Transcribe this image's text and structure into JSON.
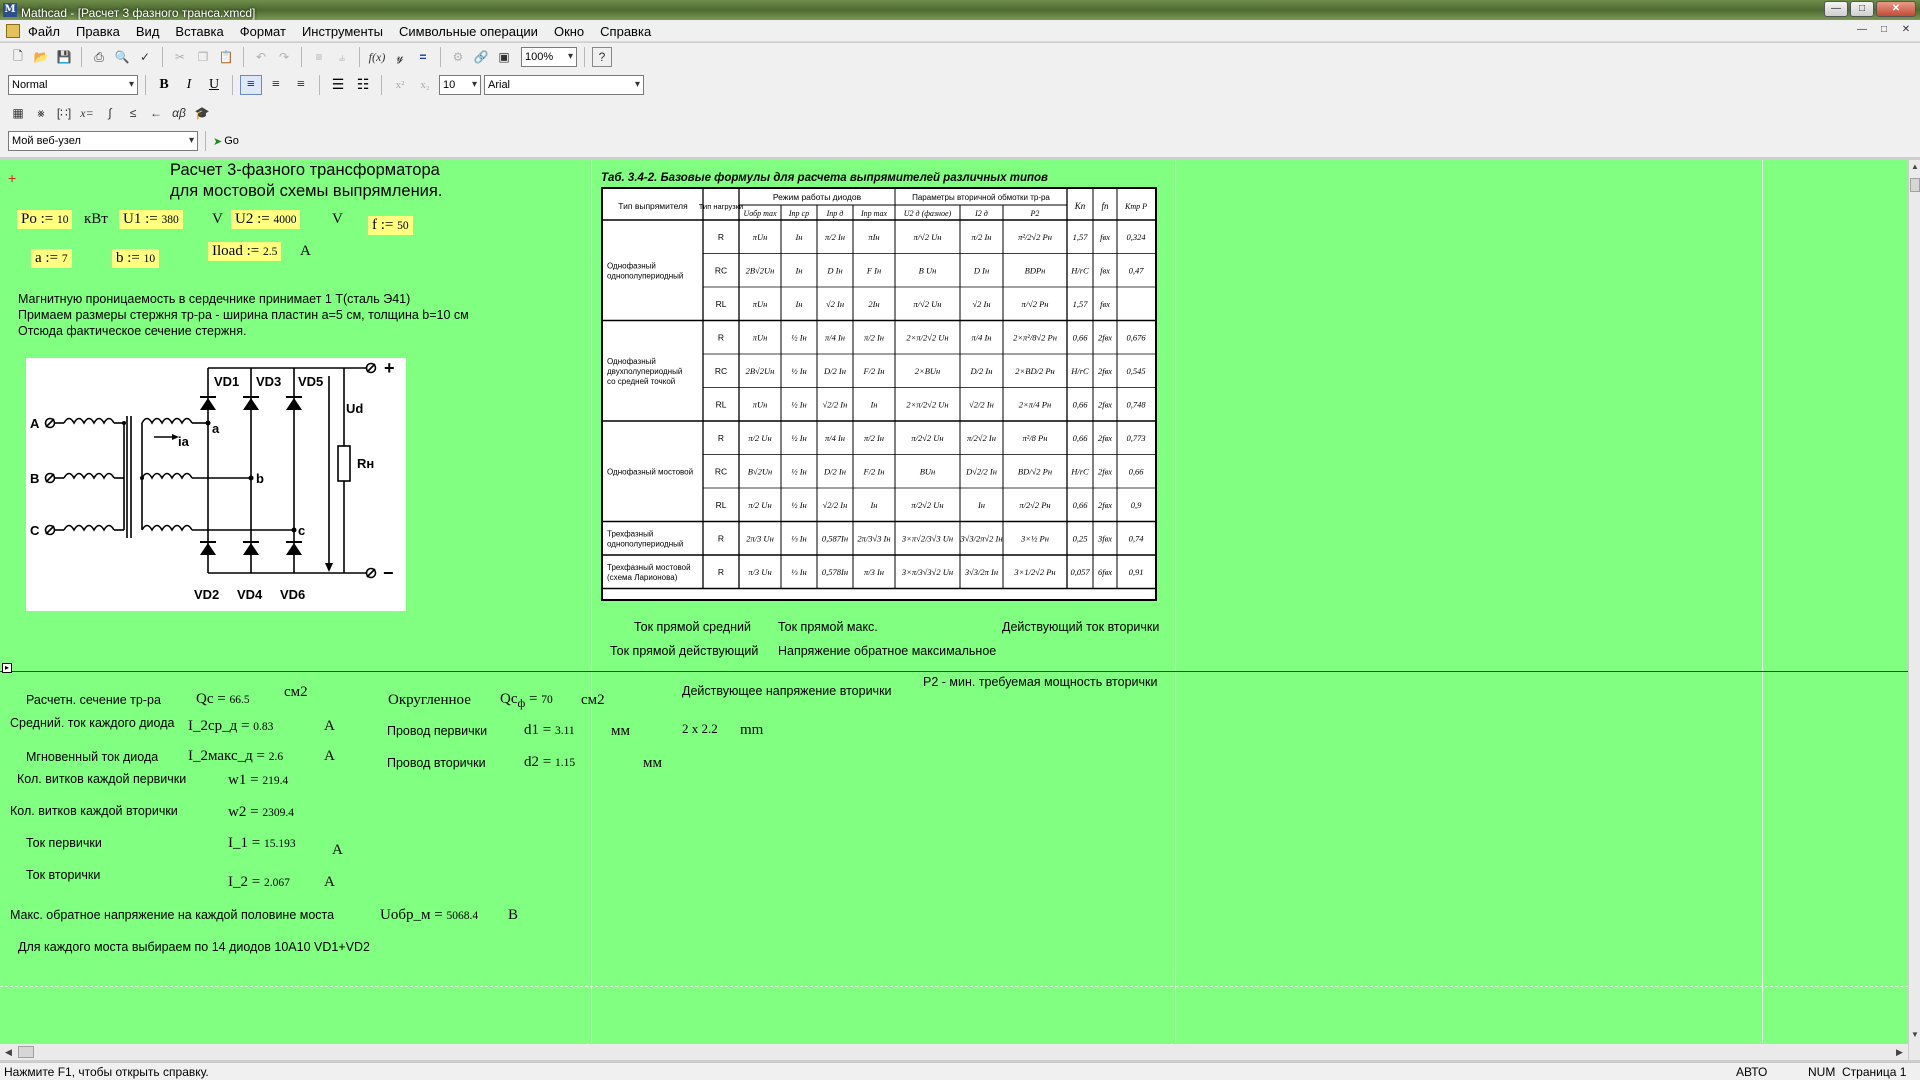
{
  "window": {
    "title": "Mathcad - [Расчет 3 фазного транса.xmcd]",
    "app_icon": "M"
  },
  "menu": [
    "Файл",
    "Правка",
    "Вид",
    "Вставка",
    "Формат",
    "Инструменты",
    "Символьные операции",
    "Окно",
    "Справка"
  ],
  "toolbar": {
    "zoom": "100%",
    "style": "Normal",
    "font_size": "10",
    "font": "Arial",
    "url": "Мой веб-узел",
    "go": "Go"
  },
  "header": {
    "title_line1": "Расчет 3-фазного трансформатора",
    "title_line2": "для мостовой схемы выпрямления."
  },
  "inputs": {
    "Po": {
      "name": "Po",
      "op": ":=",
      "value": "10",
      "unit": "кВт"
    },
    "U1": {
      "name": "U1",
      "op": ":=",
      "value": "380",
      "unit": "V"
    },
    "U2": {
      "name": "U2",
      "op": ":=",
      "value": "4000",
      "unit": "V"
    },
    "f": {
      "name": "f",
      "op": ":=",
      "value": "50"
    },
    "a": {
      "name": "a",
      "op": ":=",
      "value": "7"
    },
    "b": {
      "name": "b",
      "op": ":=",
      "value": "10"
    },
    "Iload": {
      "name": "Iload",
      "op": ":=",
      "value": "2.5",
      "unit": "A"
    }
  },
  "notes": [
    "Магнитную проницаемость в сердечнике принимает 1 Т(сталь Э41)",
    "Примаем размеры стержня тр-ра - ширина пластин а=5 см, толщина b=10 см",
    "Отсюда фактическое сечение стержня."
  ],
  "circuit": {
    "phases": [
      "A",
      "B",
      "C"
    ],
    "nodes": [
      "a",
      "b",
      "c"
    ],
    "current": "ia",
    "diodes_top": [
      "VD1",
      "VD3",
      "VD5"
    ],
    "diodes_bottom": [
      "VD2",
      "VD4",
      "VD6"
    ],
    "voltage": "Ud",
    "load": "Rн",
    "plus": "+",
    "minus": "−"
  },
  "formula_table": {
    "caption": "Таб. 3.4-2. Базовые формулы для расчета выпрямителей различных типов",
    "headers": {
      "type": "Тип выпрямителя",
      "load": "Тип нагрузки",
      "diode_mode": "Режим работы диодов",
      "secondary": "Параметры вторичной обмотки тр-ра",
      "Uobr": "Uобр max",
      "Ipr_sr": "Iпр ср",
      "Ipr_d": "Iпр д",
      "Ipr_max": "Iпр max",
      "U2d": "U2 д (фазное)",
      "I2d": "I2 д",
      "P2": "P2",
      "Kp": "Kп",
      "fp": "fп",
      "Ktr": "Kтр Р"
    },
    "groups": [
      {
        "name_lines": [
          "Однофазный",
          "однополупериодный"
        ],
        "rows": [
          {
            "load": "R",
            "cells": [
              "πUн",
              "Iн",
              "π/2 Iн",
              "πIн",
              "π/√2 Uн",
              "π/2 Iн",
              "π²/2√2 Pн",
              "1,57",
              "fвх",
              "0,324"
            ]
          },
          {
            "load": "RC",
            "cells": [
              "2B√2Uн",
              "Iн",
              "D Iн",
              "F Iн",
              "B Uн",
              "D Iн",
              "BDPн",
              "H/rC",
              "fвх",
              "0,47"
            ]
          },
          {
            "load": "RL",
            "cells": [
              "πUн",
              "Iн",
              "√2 Iн",
              "2Iн",
              "π/√2 Uн",
              "√2 Iн",
              "π/√2 Pн",
              "1,57",
              "fвх",
              ""
            ]
          }
        ]
      },
      {
        "name_lines": [
          "Однофазный",
          "двухполупериодный",
          "со средней точкой"
        ],
        "rows": [
          {
            "load": "R",
            "cells": [
              "πUн",
              "½ Iн",
              "π/4 Iн",
              "π/2 Iн",
              "2×π/2√2 Uн",
              "π/4 Iн",
              "2×π²/8√2 Pн",
              "0,66",
              "2fвх",
              "0,676"
            ]
          },
          {
            "load": "RC",
            "cells": [
              "2B√2Uн",
              "½ Iн",
              "D/2 Iн",
              "F/2 Iн",
              "2×BUн",
              "D/2 Iн",
              "2×BD/2 Pн",
              "H/rC",
              "2fвх",
              "0,545"
            ]
          },
          {
            "load": "RL",
            "cells": [
              "πUн",
              "½ Iн",
              "√2/2 Iн",
              "Iн",
              "2×π/2√2 Uн",
              "√2/2 Iн",
              "2×π/4 Pн",
              "0,66",
              "2fвх",
              "0,748"
            ]
          }
        ]
      },
      {
        "name_lines": [
          "Однофазный мостовой"
        ],
        "rows": [
          {
            "load": "R",
            "cells": [
              "π/2 Uн",
              "½ Iн",
              "π/4 Iн",
              "π/2 Iн",
              "π/2√2 Uн",
              "π/2√2 Iн",
              "π²/8 Pн",
              "0,66",
              "2fвх",
              "0,773"
            ]
          },
          {
            "load": "RC",
            "cells": [
              "B√2Uн",
              "½ Iн",
              "D/2 Iн",
              "F/2 Iн",
              "BUн",
              "D√2/2 Iн",
              "BD/√2 Pн",
              "H/rC",
              "2fвх",
              "0,66"
            ]
          },
          {
            "load": "RL",
            "cells": [
              "π/2 Uн",
              "½ Iн",
              "√2/2 Iн",
              "Iн",
              "π/2√2 Uн",
              "Iн",
              "π/2√2 Pн",
              "0,66",
              "2fвх",
              "0,9"
            ]
          }
        ]
      },
      {
        "name_lines": [
          "Трехфазный",
          "однополупериодный"
        ],
        "rows": [
          {
            "load": "R",
            "cells": [
              "2π/3 Uн",
              "⅓ Iн",
              "0,587Iн",
              "2π/3√3 Iн",
              "3×π√2/3√3 Uн",
              "3√3/2π√2 Iн",
              "3×½ Pн",
              "0,25",
              "3fвх",
              "0,74"
            ]
          }
        ]
      },
      {
        "name_lines": [
          "Трехфазный мостовой",
          "(схема Ларионова)"
        ],
        "rows": [
          {
            "load": "R",
            "cells": [
              "π/3 Uн",
              "⅓ Iн",
              "0,578Iн",
              "π/3 Iн",
              "3×π/3√3√2 Uн",
              "3√3/2π Iн",
              "3×1/2√2 Pн",
              "0,057",
              "6fвх",
              "0,91"
            ]
          }
        ]
      }
    ]
  },
  "labels": {
    "pr_sr": "Ток прямой средний",
    "pr_max": "Ток прямой макс.",
    "sec_current": "Действующий ток вторички",
    "pr_d": "Ток прямой действующий",
    "obr_max": "Напряжение обратное максимальное",
    "sec_voltage": "Действующее напряжение вторички",
    "p2_note": "P2 - мин. требуемая мощность вторички"
  },
  "results": {
    "qc_label": "Расчетн. сечение тр-ра",
    "qc": {
      "name": "Qc",
      "op": "=",
      "value": "66.5",
      "unit": "см2"
    },
    "qcf_label": "Округленное",
    "qcf": {
      "name": "Qc",
      "sub": "ф",
      "op": "=",
      "value": "70",
      "unit": "см2"
    },
    "i2sr_label": "Средний. ток каждого диода",
    "i2sr": {
      "name": "I_2ср_д",
      "op": "=",
      "value": "0.83",
      "unit": "A"
    },
    "d1_label": "Провод первички",
    "d1": {
      "name": "d1",
      "op": "=",
      "value": "3.11",
      "unit": "мм"
    },
    "wire": {
      "value": "2 x 2.2",
      "unit": "mm"
    },
    "i2max_label": "Мгновенный ток диода",
    "i2max": {
      "name": "I_2макс_д",
      "op": "=",
      "value": "2.6",
      "unit": "A"
    },
    "d2_label": "Провод вторички",
    "d2": {
      "name": "d2",
      "op": "=",
      "value": "1.15",
      "unit": "мм"
    },
    "w1_label": "Кол. витков каждой первички",
    "w1": {
      "name": "w1",
      "op": "=",
      "value": "219.4"
    },
    "w2_label": "Кол. витков каждой вторички",
    "w2": {
      "name": "w2",
      "op": "=",
      "value": "2309.4"
    },
    "i1_label": "Ток первички",
    "i1": {
      "name": "I_1",
      "op": "=",
      "value": "15.193",
      "unit": "A"
    },
    "i2_label": "Ток вторички",
    "i2": {
      "name": "I_2",
      "op": "=",
      "value": "2.067",
      "unit": "A"
    },
    "uobr_label": "Макс. обратное напряжение на каждой половине моста",
    "uobr": {
      "name": "Uобр_м",
      "op": "=",
      "value": "5068.4",
      "unit": "В"
    },
    "final_note": "Для каждого моста выбираем по 14 диодов 10А10 VD1+VD2"
  },
  "status": {
    "help": "Нажмите F1, чтобы открыть справку.",
    "mode": "АВТО",
    "num": "NUM",
    "page": "Страница 1"
  }
}
